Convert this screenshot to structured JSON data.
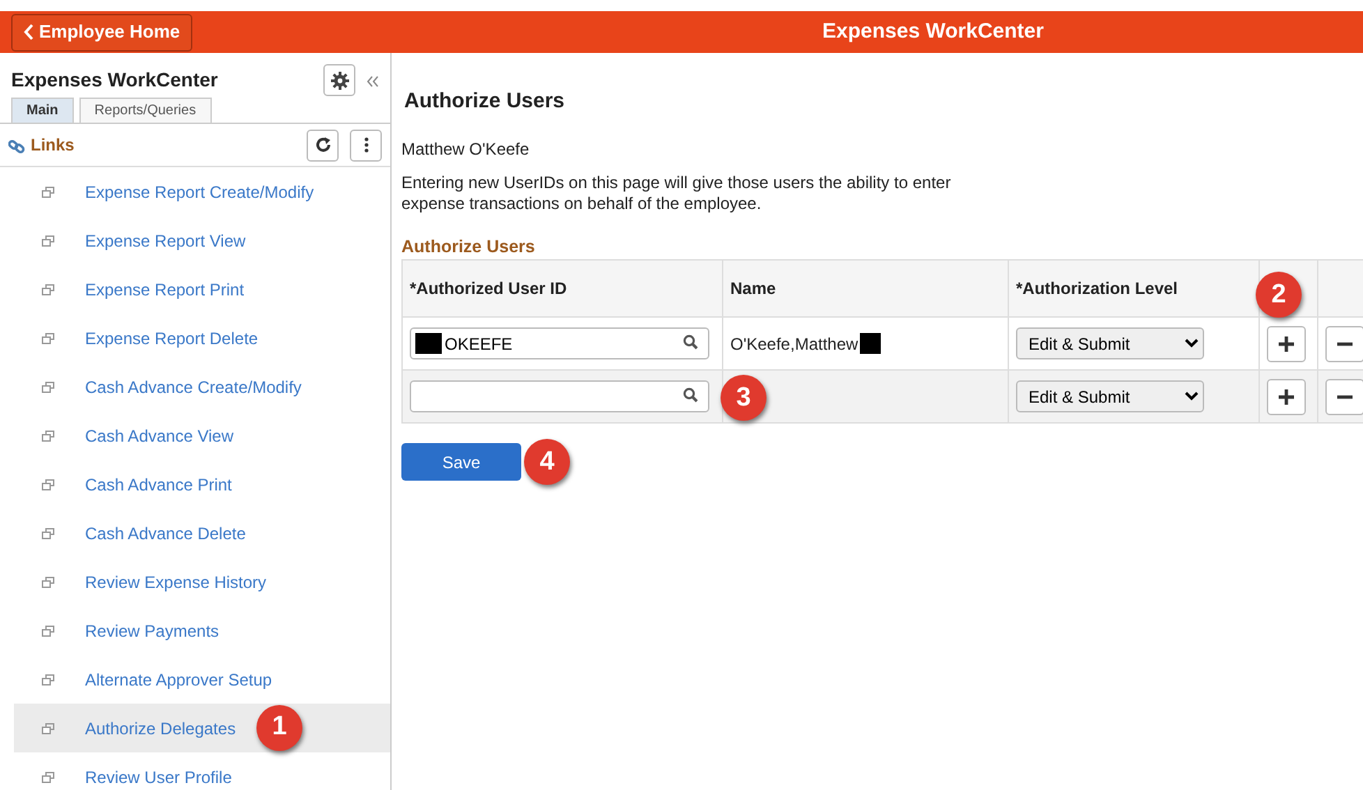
{
  "header": {
    "back_button": "Employee Home",
    "title": "Expenses WorkCenter"
  },
  "sidebar": {
    "title": "Expenses WorkCenter",
    "tabs": [
      {
        "label": "Main",
        "selected": true
      },
      {
        "label": "Reports/Queries",
        "selected": false
      }
    ],
    "section": "Links",
    "items": [
      {
        "label": "Expense Report Create/Modify",
        "selected": false
      },
      {
        "label": "Expense Report View",
        "selected": false
      },
      {
        "label": "Expense Report Print",
        "selected": false
      },
      {
        "label": "Expense Report Delete",
        "selected": false
      },
      {
        "label": "Cash Advance Create/Modify",
        "selected": false
      },
      {
        "label": "Cash Advance View",
        "selected": false
      },
      {
        "label": "Cash Advance Print",
        "selected": false
      },
      {
        "label": "Cash Advance Delete",
        "selected": false
      },
      {
        "label": "Review Expense History",
        "selected": false
      },
      {
        "label": "Review Payments",
        "selected": false
      },
      {
        "label": "Alternate Approver Setup",
        "selected": false
      },
      {
        "label": "Authorize Delegates",
        "selected": true,
        "callout": "1"
      },
      {
        "label": "Review User Profile",
        "selected": false
      }
    ]
  },
  "main": {
    "title": "Authorize Users",
    "employee": "Matthew O'Keefe",
    "description": "Entering new UserIDs on this page will give those users the ability to enter expense transactions on behalf of the employee.",
    "grid_title": "Authorize Users",
    "columns": [
      "*Authorized User ID",
      "Name",
      "*Authorization Level"
    ],
    "add_callout": "2",
    "rows": [
      {
        "user_id": "OKEEFE",
        "redacted": true,
        "name": "O'Keefe,Matthew",
        "level": "Edit & Submit"
      },
      {
        "user_id": "",
        "redacted": false,
        "name": "",
        "level": "Edit & Submit",
        "callout": "3"
      }
    ],
    "save": "Save",
    "save_callout": "4"
  }
}
